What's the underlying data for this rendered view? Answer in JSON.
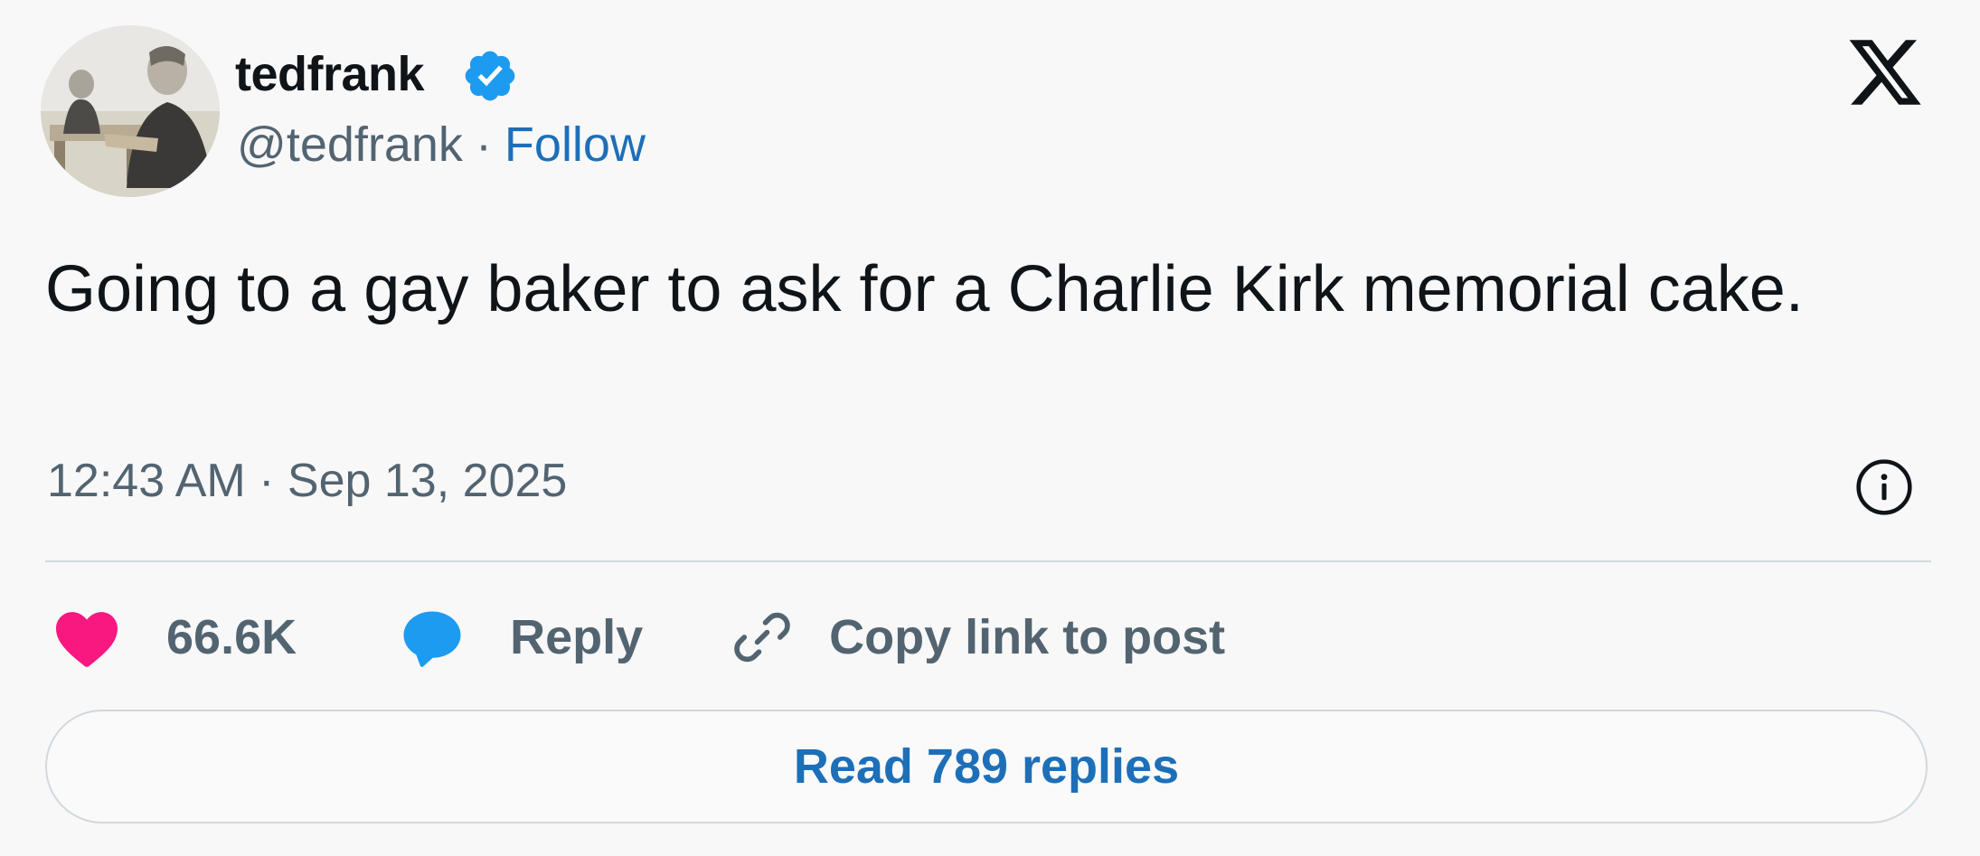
{
  "author": {
    "display_name": "tedfrank",
    "handle": "@tedfrank",
    "separator": "·",
    "follow_label": "Follow",
    "verified": true,
    "avatar_icon": "courtroom-sketch-avatar",
    "verified_icon": "verified-badge-icon"
  },
  "brand": {
    "logo_icon": "x-logo-icon"
  },
  "tweet": {
    "text": "Going to a gay baker to ask for a Charlie Kirk memorial cake.",
    "timestamp": "12:43 AM · Sep 13, 2025"
  },
  "actions": {
    "like_count": "66.6K",
    "reply_label": "Reply",
    "copy_link_label": "Copy link to post"
  },
  "read_replies_label": "Read 789 replies",
  "colors": {
    "like": "#f91880",
    "reply": "#1d9bf0",
    "link_blue": "#1d6fb8",
    "muted": "#536471",
    "text": "#0f1419",
    "verified": "#1d9bf0"
  }
}
